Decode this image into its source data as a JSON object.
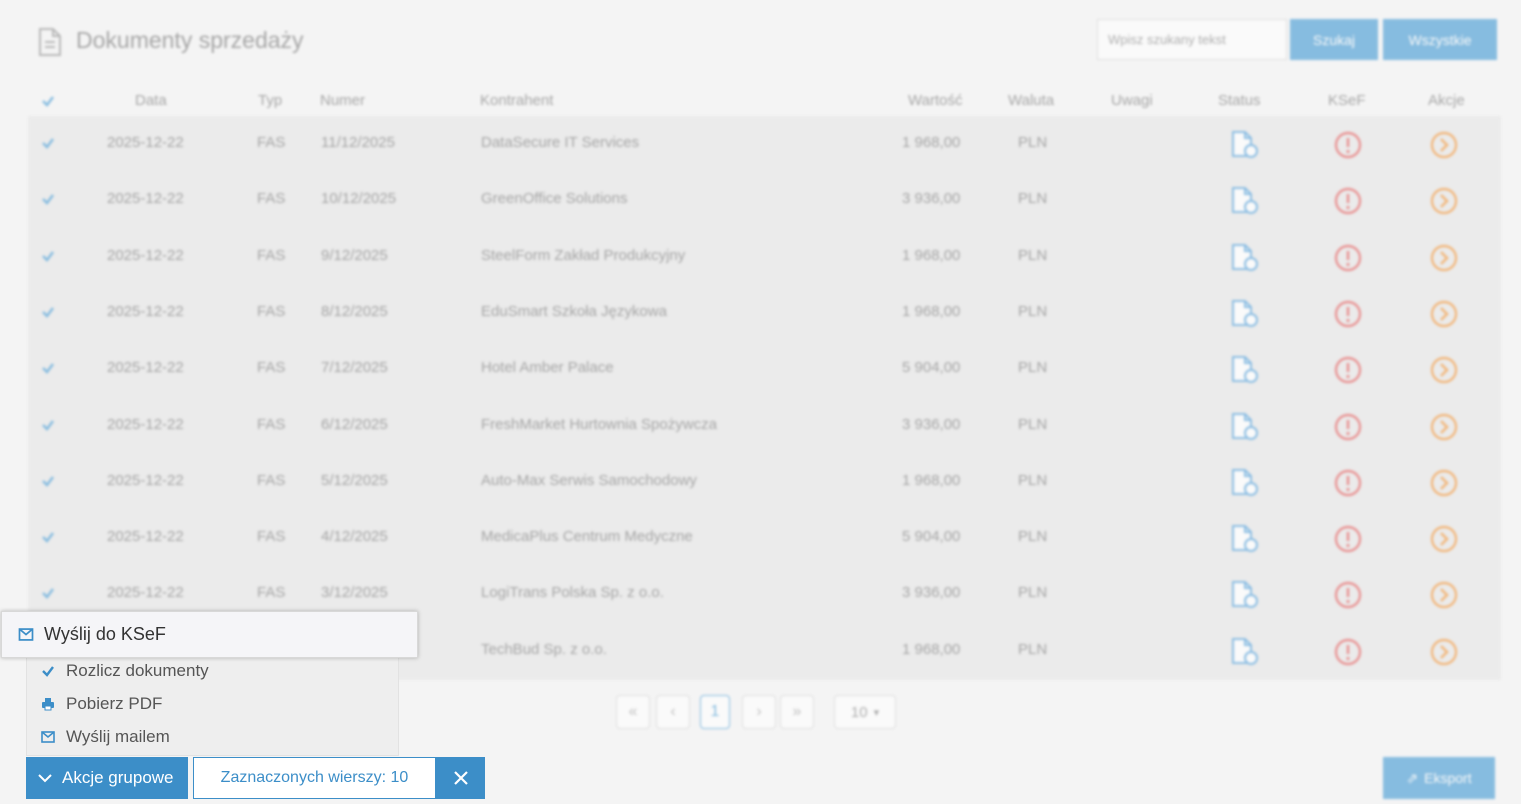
{
  "header": {
    "title": "Dokumenty sprzedaży",
    "search_placeholder": "Wpisz szukany tekst",
    "search_button": "Szukaj",
    "all_button": "Wszystkie"
  },
  "table": {
    "columns": {
      "date": "Data",
      "type": "Typ",
      "number": "Numer",
      "contractor": "Kontrahent",
      "value": "Wartość",
      "currency": "Waluta",
      "notes": "Uwagi",
      "status": "Status",
      "ksef": "KSeF",
      "actions": "Akcje"
    },
    "rows": [
      {
        "date": "2025-12-22",
        "type": "FAS",
        "number": "11/12/2025",
        "contractor": "DataSecure IT Services",
        "value": "1 968,00",
        "currency": "PLN"
      },
      {
        "date": "2025-12-22",
        "type": "FAS",
        "number": "10/12/2025",
        "contractor": "GreenOffice Solutions",
        "value": "3 936,00",
        "currency": "PLN"
      },
      {
        "date": "2025-12-22",
        "type": "FAS",
        "number": "9/12/2025",
        "contractor": "SteelForm Zakład Produkcyjny",
        "value": "1 968,00",
        "currency": "PLN"
      },
      {
        "date": "2025-12-22",
        "type": "FAS",
        "number": "8/12/2025",
        "contractor": "EduSmart Szkoła Językowa",
        "value": "1 968,00",
        "currency": "PLN"
      },
      {
        "date": "2025-12-22",
        "type": "FAS",
        "number": "7/12/2025",
        "contractor": "Hotel Amber Palace",
        "value": "5 904,00",
        "currency": "PLN"
      },
      {
        "date": "2025-12-22",
        "type": "FAS",
        "number": "6/12/2025",
        "contractor": "FreshMarket Hurtownia Spożywcza",
        "value": "3 936,00",
        "currency": "PLN"
      },
      {
        "date": "2025-12-22",
        "type": "FAS",
        "number": "5/12/2025",
        "contractor": "Auto-Max Serwis Samochodowy",
        "value": "1 968,00",
        "currency": "PLN"
      },
      {
        "date": "2025-12-22",
        "type": "FAS",
        "number": "4/12/2025",
        "contractor": "MedicaPlus Centrum Medyczne",
        "value": "5 904,00",
        "currency": "PLN"
      },
      {
        "date": "2025-12-22",
        "type": "FAS",
        "number": "3/12/2025",
        "contractor": "LogiTrans Polska Sp. z o.o.",
        "value": "3 936,00",
        "currency": "PLN"
      },
      {
        "date": "",
        "type": "",
        "number": "",
        "contractor": "TechBud Sp. z o.o.",
        "value": "1 968,00",
        "currency": "PLN"
      }
    ]
  },
  "pagination": {
    "current_page": "1",
    "page_size": "10"
  },
  "export_button": "Eksport",
  "group_actions": {
    "button_label": "Akcje grupowe",
    "selected_count_label": "Zaznaczonych wierszy: 10",
    "highlighted_item": "Wyślij do KSeF",
    "items": [
      "Rozlicz dokumenty",
      "Pobierz PDF",
      "Wyślij mailem"
    ]
  },
  "colors": {
    "primary": "#2e8fd0",
    "ksef_error": "#e04a4a",
    "action_orange": "#f08a24",
    "status_blue": "#3a93d6"
  }
}
